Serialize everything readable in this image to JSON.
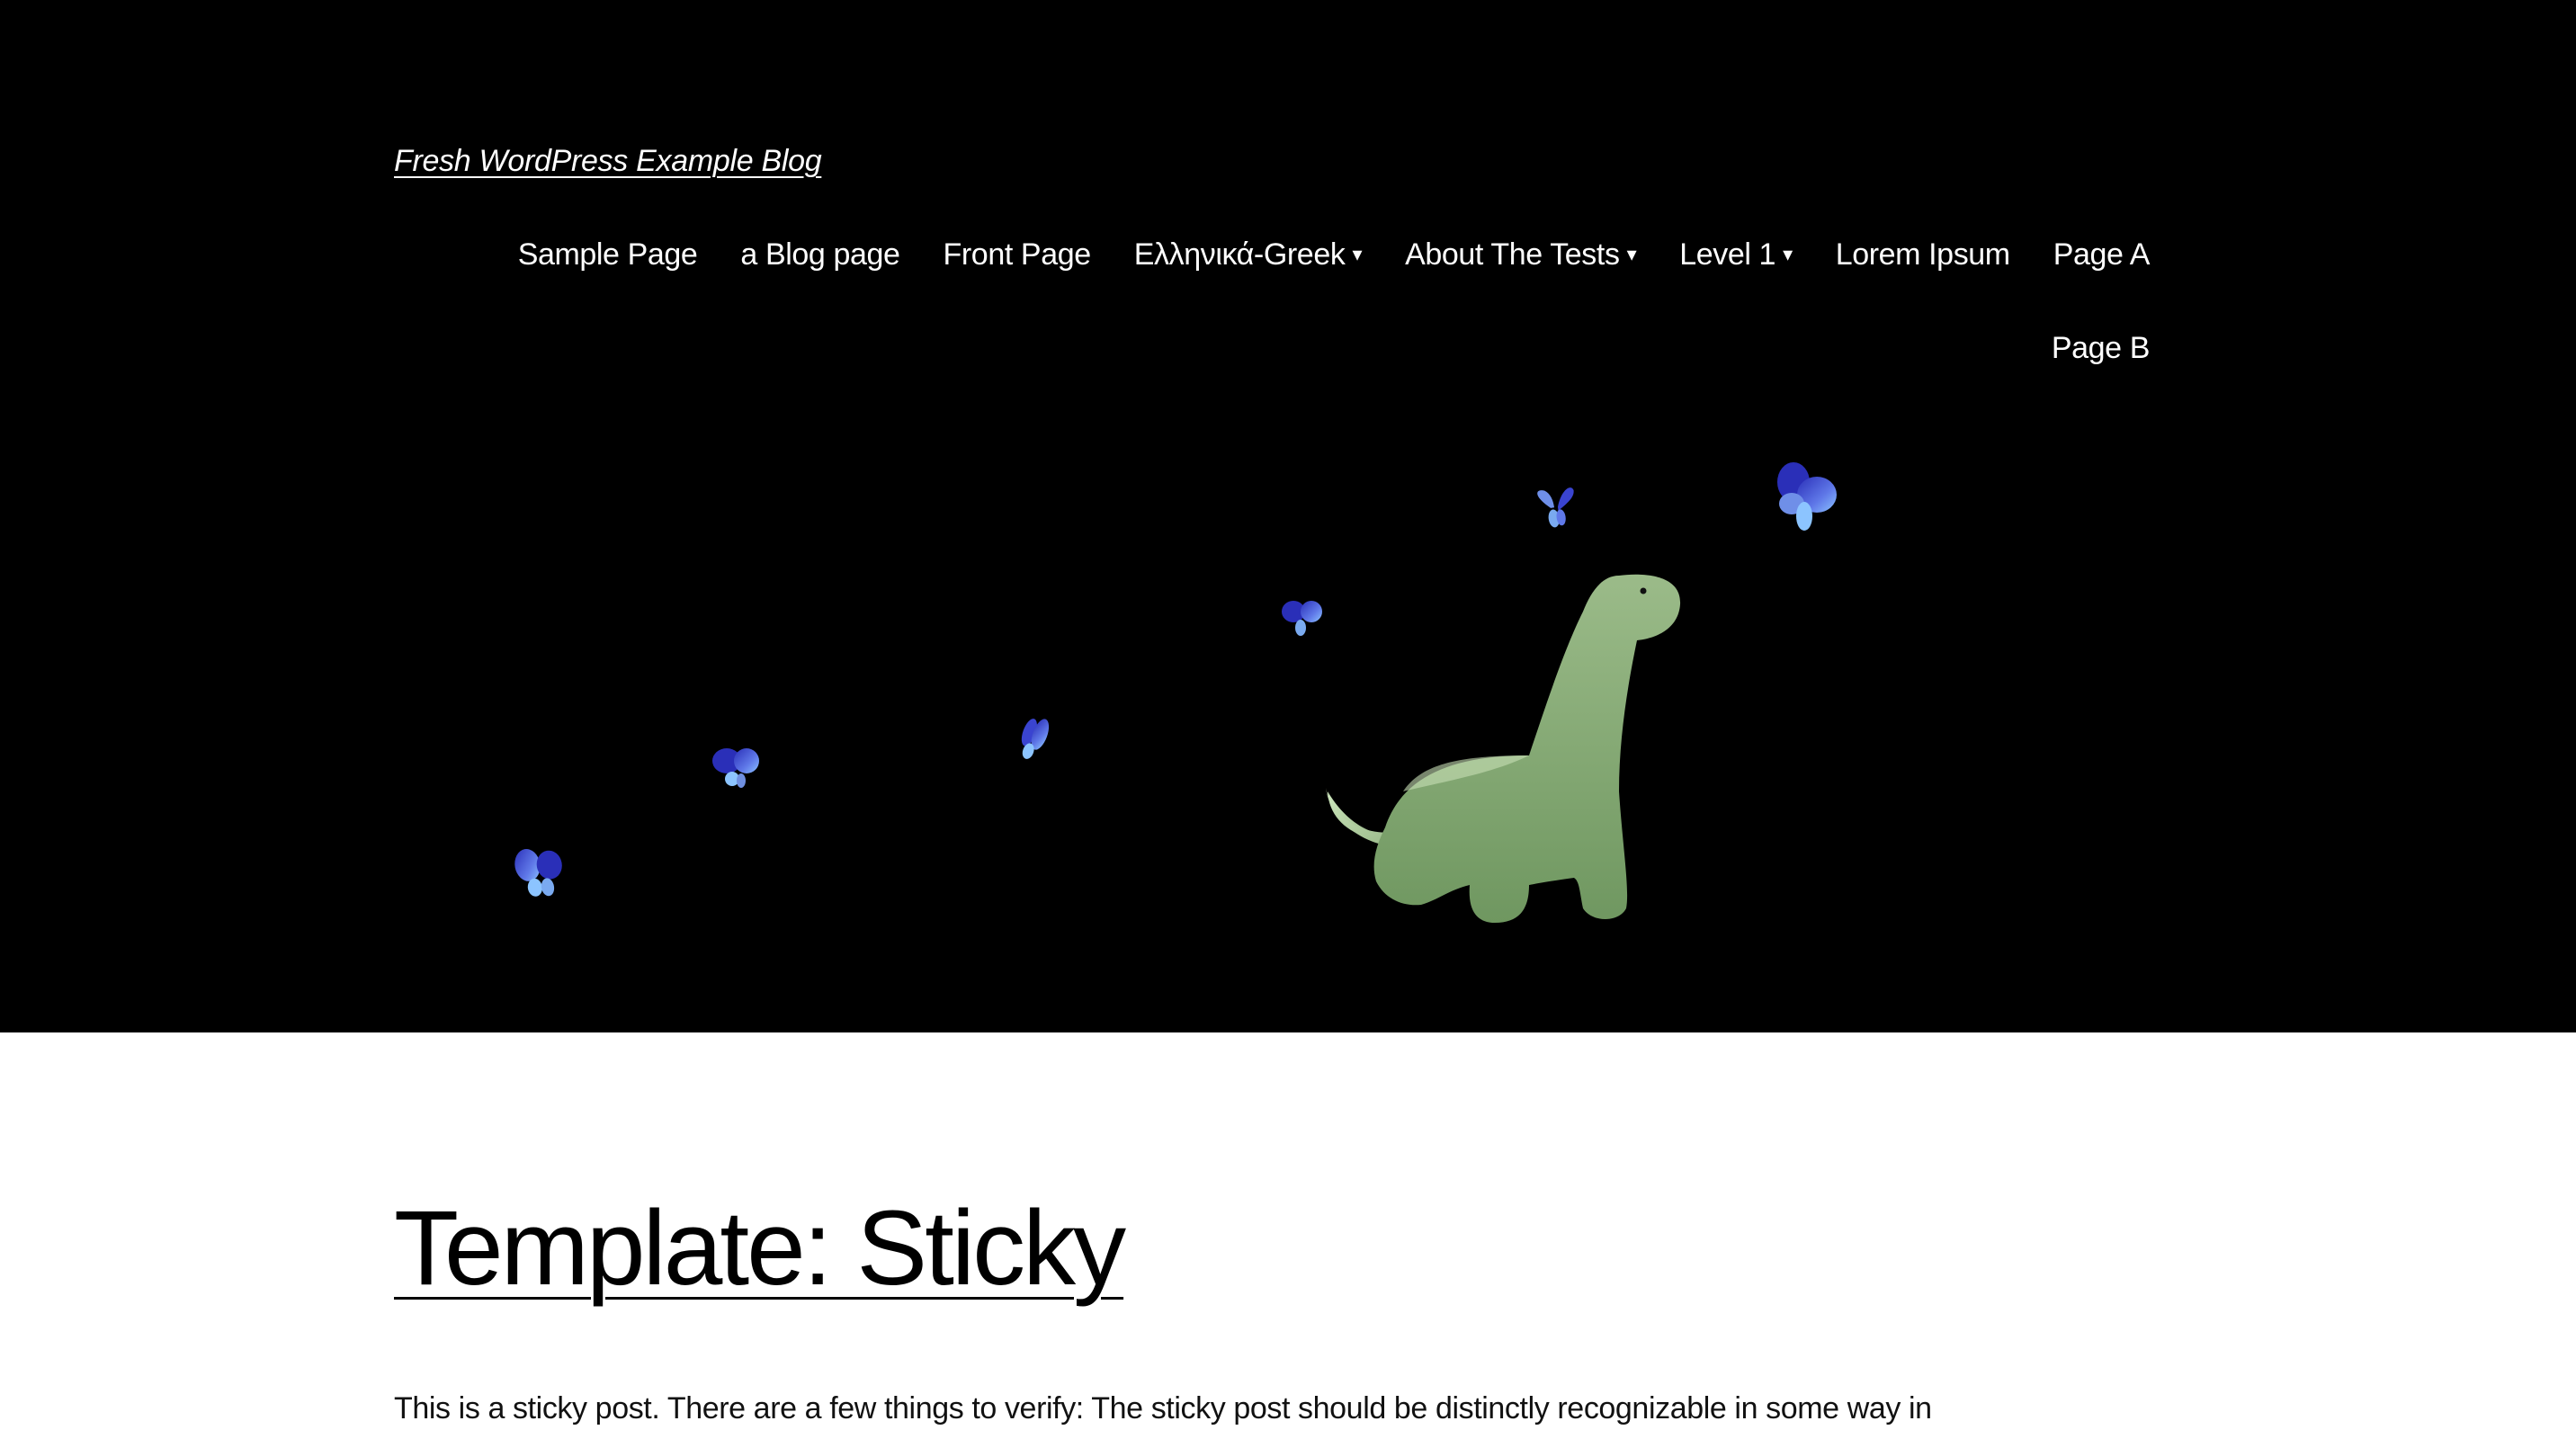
{
  "site": {
    "title": "Fresh WordPress Example Blog"
  },
  "nav": {
    "items": [
      {
        "label": "Sample Page",
        "has_submenu": false
      },
      {
        "label": "a Blog page",
        "has_submenu": false
      },
      {
        "label": "Front Page",
        "has_submenu": false
      },
      {
        "label": "Ελληνικά-Greek",
        "has_submenu": true
      },
      {
        "label": "About The Tests",
        "has_submenu": true
      },
      {
        "label": "Level 1",
        "has_submenu": true
      },
      {
        "label": "Lorem Ipsum",
        "has_submenu": false
      },
      {
        "label": "Page A",
        "has_submenu": false
      },
      {
        "label": "Page B",
        "has_submenu": false
      }
    ],
    "submenu_icon": "▾"
  },
  "hero": {
    "description": "green dinosaur with blue butterflies",
    "colors": {
      "background": "#000000",
      "dino": "#8fb07f",
      "butterfly": "#5a6be0"
    }
  },
  "post": {
    "title": "Template: Sticky",
    "excerpt": "This is a sticky post. There are a few things to verify: The sticky post should be distinctly recognizable in some way in"
  }
}
